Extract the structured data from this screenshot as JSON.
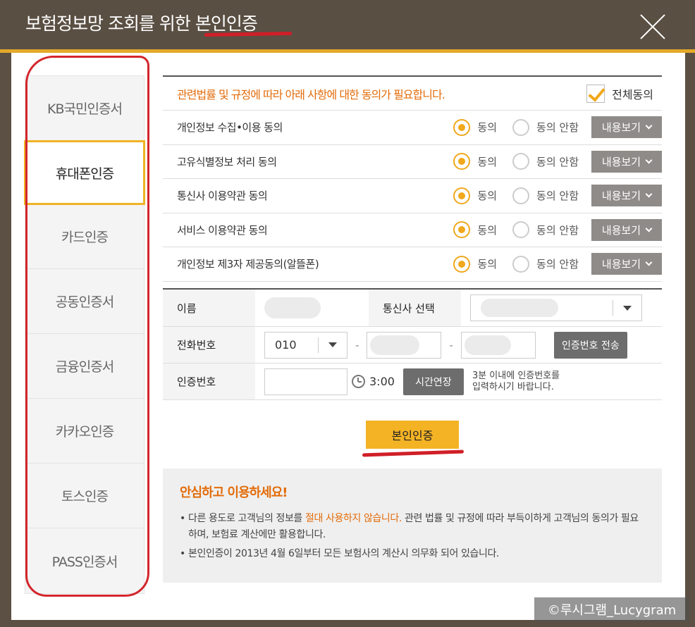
{
  "header": {
    "title": "보험정보망 조회를 위한 본인인증"
  },
  "sidebar": {
    "items": [
      {
        "label": "KB국민인증서"
      },
      {
        "label": "휴대폰인증"
      },
      {
        "label": "카드인증"
      },
      {
        "label": "공동인증서"
      },
      {
        "label": "금융인증서"
      },
      {
        "label": "카카오인증"
      },
      {
        "label": "토스인증"
      },
      {
        "label": "PASS인증서"
      }
    ],
    "active_index": 1
  },
  "agreements": {
    "notice": "관련법률 및 규정에 따라 아래 사항에 대한 동의가 필요합니다.",
    "all_label": "전체동의",
    "all_checked": true,
    "agree_label": "동의",
    "disagree_label": "동의 안함",
    "view_label": "내용보기",
    "rows": [
      {
        "label": "개인정보 수집•이용 동의"
      },
      {
        "label": "고유식별정보 처리 동의"
      },
      {
        "label": "통신사 이용약관 동의"
      },
      {
        "label": "서비스 이용약관 동의"
      },
      {
        "label": "개인정보 제3자 제공동의(알뜰폰)"
      }
    ]
  },
  "form": {
    "name_label": "이름",
    "carrier_label": "통신사 선택",
    "phone_label": "전화번호",
    "phone_prefix": "010",
    "dash": "-",
    "send_code_label": "인증번호 전송",
    "code_label": "인증번호",
    "timer": "3:00",
    "extend_label": "시간연장",
    "help_line1": "3분 이내에 인증번호를",
    "help_line2": "입력하시기 바랍니다."
  },
  "auth_button": {
    "label": "본인인증"
  },
  "info": {
    "title": "안심하고 이용하세요!",
    "item1_before": "다른 용도로 고객님의 정보를 ",
    "item1_highlight": "절대 사용하지 않습니다.",
    "item1_after": " 관련 법률 및 규정에 따라 부득이하게 고객님의 동의가 필요하며, 보험료 계산에만 활용합니다.",
    "item2": "본인인증이 2013년 4월 6일부터 모든 보험사의 계산시 의무화 되어 있습니다."
  },
  "watermark": {
    "text": "©루시그램_Lucygram"
  },
  "colors": {
    "accent": "#f0a81c",
    "notice": "#e36c0a",
    "header": "#5a4f43",
    "annotation_red": "#d01f28"
  }
}
